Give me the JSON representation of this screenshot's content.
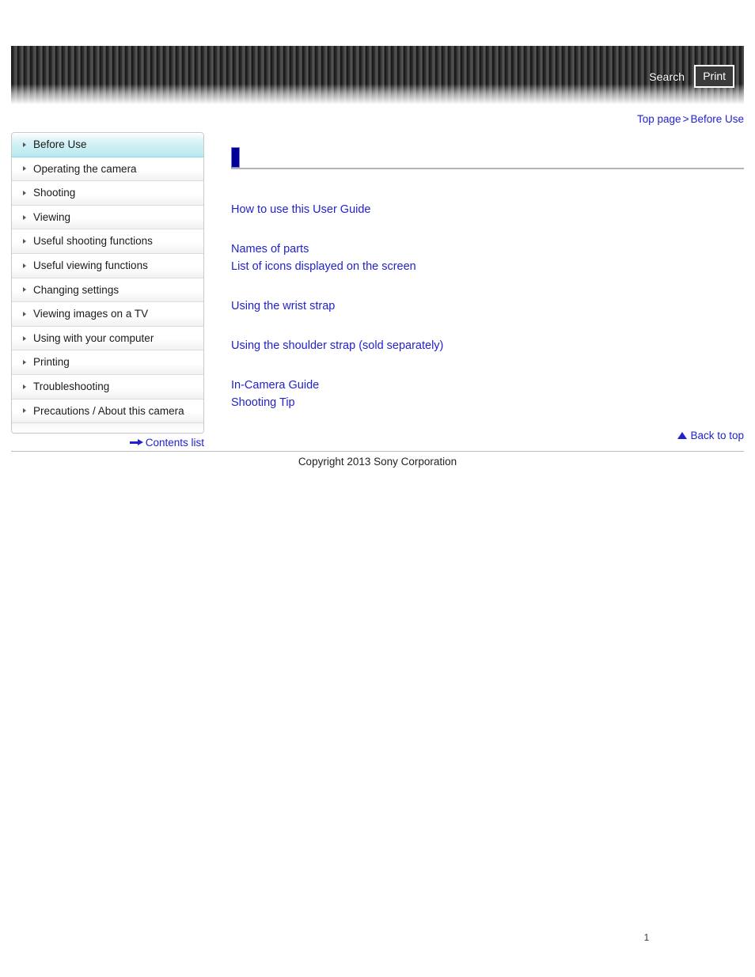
{
  "header": {
    "search_label": "Search",
    "print_label": "Print",
    "stripe_color_dark": "#1b1b1b",
    "stripe_color_light": "#5a5a5a"
  },
  "breadcrumb": {
    "top_label": "Top page",
    "separator": ">",
    "current_label": "Before Use"
  },
  "sidebar": {
    "items": [
      {
        "label": "Before Use",
        "active": true
      },
      {
        "label": "Operating the camera",
        "active": false
      },
      {
        "label": "Shooting",
        "active": false
      },
      {
        "label": "Viewing",
        "active": false
      },
      {
        "label": "Useful shooting functions",
        "active": false
      },
      {
        "label": "Useful viewing functions",
        "active": false
      },
      {
        "label": "Changing settings",
        "active": false
      },
      {
        "label": "Viewing images on a TV",
        "active": false
      },
      {
        "label": "Using with your computer",
        "active": false
      },
      {
        "label": "Printing",
        "active": false
      },
      {
        "label": "Troubleshooting",
        "active": false
      },
      {
        "label": "Precautions / About this camera",
        "active": false
      }
    ],
    "contents_list_label": "Contents list",
    "contents_list_icon": "arrow-right-icon",
    "active_color": "#b7e9f0"
  },
  "main": {
    "heading_title": "",
    "heading_marker_color": "#000099",
    "link_groups": [
      {
        "links": [
          "How to use this User Guide"
        ]
      },
      {
        "links": [
          "Names of parts",
          "List of icons displayed on the screen"
        ]
      },
      {
        "links": [
          "Using the wrist strap"
        ]
      },
      {
        "links": [
          "Using the shoulder strap (sold separately)"
        ]
      },
      {
        "links": [
          "In-Camera Guide",
          "Shooting Tip"
        ]
      }
    ],
    "link_color": "#2222cc"
  },
  "footer": {
    "back_to_top_label": "Back to top",
    "back_to_top_icon": "triangle-up-icon",
    "copyright": "Copyright 2013 Sony Corporation",
    "page_number": "1"
  }
}
